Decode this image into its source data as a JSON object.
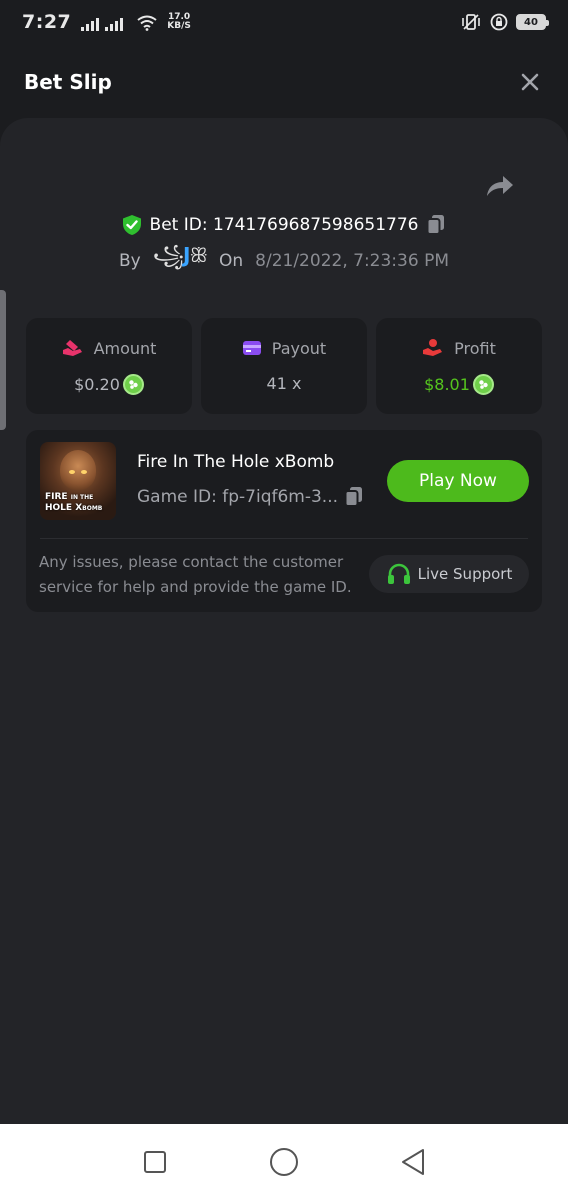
{
  "status_bar": {
    "time": "7:27",
    "net_speed_value": "17.0",
    "net_speed_unit": "KB/S",
    "battery": "40"
  },
  "header": {
    "title": "Bet Slip"
  },
  "bet": {
    "id_label": "Bet ID: 1741769687598651776",
    "by_label": "By",
    "username_pre": "꧁",
    "username_mid": "J",
    "username_post": "ꕥ",
    "on_label": "On",
    "date": "8/21/2022, 7:23:36 PM"
  },
  "stats": [
    {
      "label": "Amount",
      "value": "$0.20",
      "icon": "money-hand-icon"
    },
    {
      "label": "Payout",
      "value": "41 x",
      "icon": "wallet-card-icon"
    },
    {
      "label": "Profit",
      "value": "$8.01",
      "icon": "profit-hand-icon"
    }
  ],
  "game": {
    "thumb_line1": "FIRE",
    "thumb_line1_small": "IN THE",
    "thumb_line2": "HOLE X",
    "thumb_line2_small": "BOMB",
    "name": "Fire In The Hole xBomb",
    "game_id": "Game ID: fp-7iqf6m-3...",
    "play_label": "Play Now",
    "help_text": "Any issues, please contact the customer service for help and provide the game ID.",
    "support_label": "Live Support"
  },
  "colors": {
    "accent_green": "#4dba1c",
    "profit_green": "#55c41e",
    "background": "#1b1c1f",
    "panel": "#232428"
  }
}
